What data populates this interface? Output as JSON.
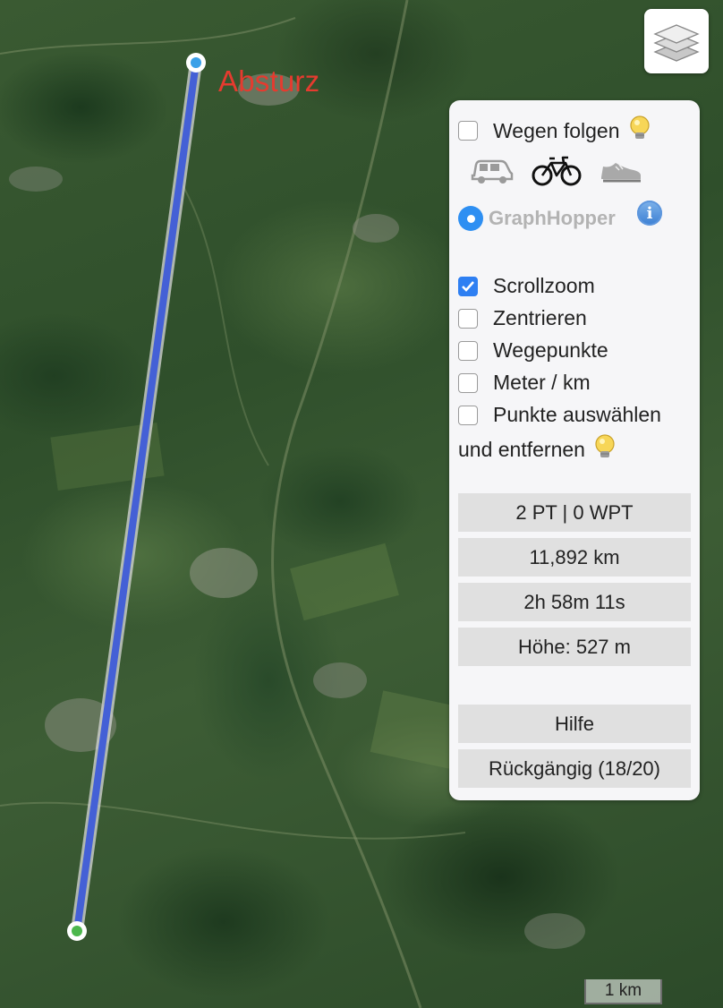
{
  "map": {
    "route_label": "Absturz",
    "route_color": "#4460d6",
    "start_marker_color": "#3aa0e8",
    "end_marker_color": "#4cb74c",
    "scale_label": "1 km"
  },
  "panel": {
    "follow_roads": {
      "label": "Wegen folgen",
      "checked": false
    },
    "modes": [
      "car-icon",
      "bicycle-icon",
      "shoe-icon"
    ],
    "routing_engine": {
      "label": "GraphHopper",
      "selected": true
    },
    "options": [
      {
        "label": "Scrollzoom",
        "checked": true
      },
      {
        "label": "Zentrieren",
        "checked": false
      },
      {
        "label": "Wegepunkte",
        "checked": false
      },
      {
        "label": "Meter / km",
        "checked": false
      },
      {
        "label": "Punkte auswählen",
        "checked": false
      }
    ],
    "options_continuation": "und entfernen",
    "stats": {
      "points": "2 PT | 0 WPT",
      "distance": "11,892 km",
      "duration": "2h 58m 11s",
      "elevation": "Höhe: 527 m"
    },
    "buttons": {
      "help": "Hilfe",
      "undo": "Rückgängig (18/20)"
    }
  },
  "colors": {
    "accent": "#2e7ff2",
    "label_red": "#e53b2f"
  }
}
